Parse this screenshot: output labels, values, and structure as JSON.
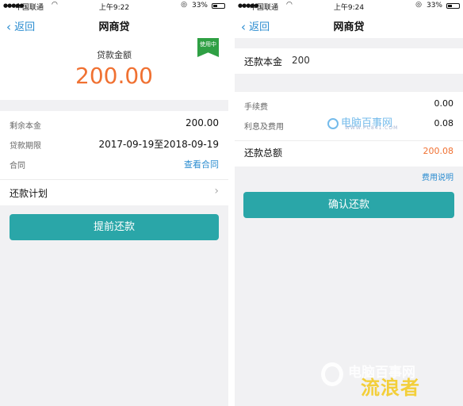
{
  "left_screen": {
    "status_bar": {
      "carrier": "中国联通",
      "time": "上午9:22",
      "battery": "33%"
    },
    "nav": {
      "back_label": "返回",
      "title": "网商贷"
    },
    "amount": {
      "label": "贷款金额",
      "value": "200.00",
      "badge": "使用中"
    },
    "details": {
      "remaining_principal": {
        "label": "剩余本金",
        "value": "200.00"
      },
      "loan_period": {
        "label": "贷款期限",
        "value": "2017-09-19至2018-09-19"
      },
      "contract": {
        "label": "合同",
        "link": "查看合同"
      }
    },
    "repay_plan": "还款计划",
    "prepay_button": "提前还款"
  },
  "right_screen": {
    "status_bar": {
      "carrier": "中国联通",
      "time": "上午9:24",
      "battery": "33%"
    },
    "nav": {
      "back_label": "返回",
      "title": "网商贷"
    },
    "principal": {
      "label": "还款本金",
      "value": "200"
    },
    "fees": {
      "handling_fee": {
        "label": "手续费",
        "value": "0.00"
      },
      "interest": {
        "label": "利息及费用",
        "value": "0.08"
      },
      "total": {
        "label": "还款总额",
        "value": "200.08"
      }
    },
    "fee_note": "费用说明",
    "confirm_button": "确认还款"
  },
  "watermarks": {
    "middle": {
      "text": "电脑百事网",
      "url": "WWW.PC841.COM"
    },
    "bottom": {
      "text": "电脑百事网",
      "tagline": "流浪者"
    }
  },
  "colors": {
    "accent": "#2aa6a8",
    "amount": "#f07132",
    "link": "#2a8cd0",
    "badge": "#2fa044"
  }
}
